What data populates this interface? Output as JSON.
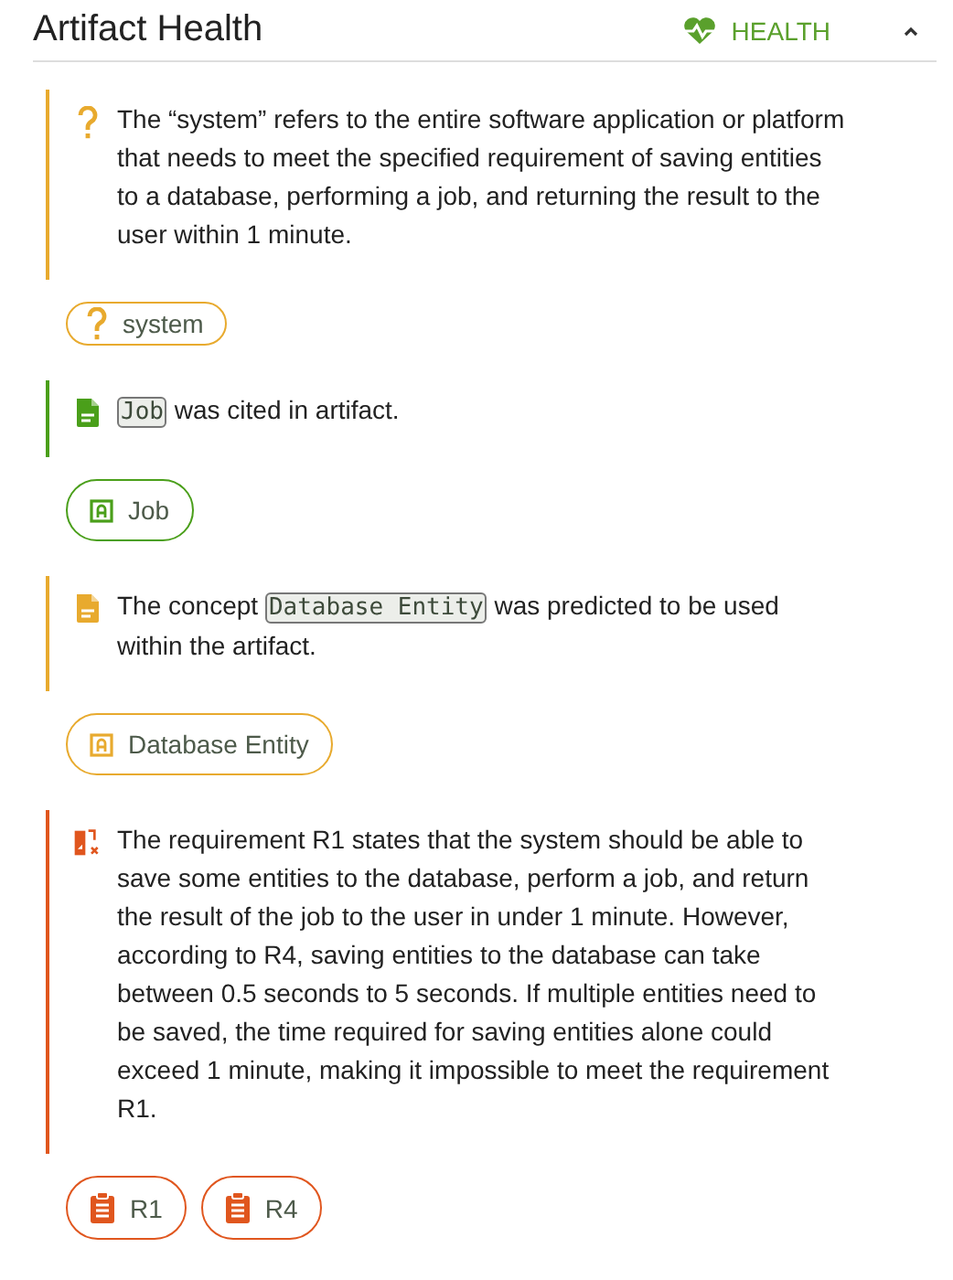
{
  "header": {
    "title": "Artifact Health",
    "badge": "HEALTH",
    "expanded": true
  },
  "insights": [
    {
      "kind": "question",
      "color": "#e8aa2e",
      "segments": [
        {
          "kind": "text",
          "text": "The “system” refers to the entire software application or platform that needs to meet the specified requirement of saving entities to a database, performing a job, and returning the result to the user within 1 minute."
        }
      ],
      "chips": [
        {
          "kind": "question",
          "label": "system"
        }
      ]
    },
    {
      "kind": "cited",
      "color": "#4a9f1a",
      "segments": [
        {
          "kind": "code",
          "text": "Job"
        },
        {
          "kind": "text",
          "text": " was cited in artifact."
        }
      ],
      "chips": [
        {
          "kind": "artifact",
          "label": "Job"
        }
      ]
    },
    {
      "kind": "predicted",
      "color": "#e8aa2e",
      "segments": [
        {
          "kind": "text",
          "text": "The concept "
        },
        {
          "kind": "code",
          "text": "Database Entity"
        },
        {
          "kind": "text",
          "text": " was predicted to be used within the artifact."
        }
      ],
      "chips": [
        {
          "kind": "artifact",
          "label": "Database Entity"
        }
      ]
    },
    {
      "kind": "conflict",
      "color": "#e0561e",
      "segments": [
        {
          "kind": "text",
          "text": "The requirement R1 states that the system should be able to save some entities to the database, perform a job, and return the result of the job to the user in under 1 minute. However, according to R4, saving entities to the database can take between 0.5 seconds to 5 seconds. If multiple entities need to be saved, the time required for saving entities alone could exceed 1 minute, making it impossible to meet the requirement R1."
        }
      ],
      "chips": [
        {
          "kind": "requirement",
          "label": "R1"
        },
        {
          "kind": "requirement",
          "label": "R4"
        }
      ]
    }
  ]
}
